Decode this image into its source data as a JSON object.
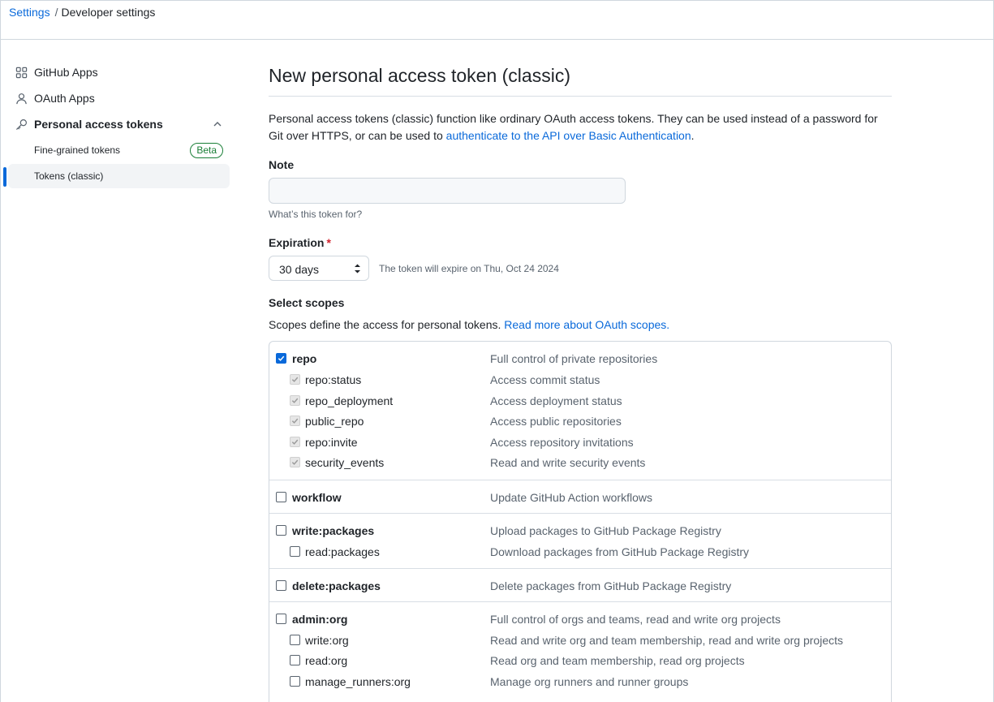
{
  "breadcrumb": {
    "settings": "Settings",
    "separator": "/",
    "current": "Developer settings"
  },
  "sidebar": {
    "items": [
      {
        "label": "GitHub Apps",
        "icon": "apps-grid-icon"
      },
      {
        "label": "OAuth Apps",
        "icon": "person-icon"
      },
      {
        "label": "Personal access tokens",
        "icon": "key-icon"
      }
    ],
    "sub_items": [
      {
        "label": "Fine-grained tokens",
        "badge": "Beta"
      },
      {
        "label": "Tokens (classic)",
        "active": true
      }
    ]
  },
  "main": {
    "title": "New personal access token (classic)",
    "intro_text": "Personal access tokens (classic) function like ordinary OAuth access tokens. They can be used instead of a password for Git over HTTPS, or can be used to ",
    "intro_link": "authenticate to the API over Basic Authentication",
    "intro_end": ".",
    "note": {
      "label": "Note",
      "value": "",
      "hint": "What’s this token for?"
    },
    "expiration": {
      "label": "Expiration",
      "required_mark": "*",
      "selected": "30 days",
      "hint": "The token will expire on Thu, Oct 24 2024"
    },
    "scopes": {
      "label": "Select scopes",
      "desc_text": "Scopes define the access for personal tokens. ",
      "desc_link": "Read more about OAuth scopes."
    }
  },
  "scopes": [
    {
      "name": "repo",
      "desc": "Full control of private repositories",
      "checked": true,
      "children": [
        {
          "name": "repo:status",
          "desc": "Access commit status"
        },
        {
          "name": "repo_deployment",
          "desc": "Access deployment status"
        },
        {
          "name": "public_repo",
          "desc": "Access public repositories"
        },
        {
          "name": "repo:invite",
          "desc": "Access repository invitations"
        },
        {
          "name": "security_events",
          "desc": "Read and write security events"
        }
      ]
    },
    {
      "name": "workflow",
      "desc": "Update GitHub Action workflows",
      "checked": false,
      "children": []
    },
    {
      "name": "write:packages",
      "desc": "Upload packages to GitHub Package Registry",
      "checked": false,
      "children": [
        {
          "name": "read:packages",
          "desc": "Download packages from GitHub Package Registry"
        }
      ]
    },
    {
      "name": "delete:packages",
      "desc": "Delete packages from GitHub Package Registry",
      "checked": false,
      "children": []
    },
    {
      "name": "admin:org",
      "desc": "Full control of orgs and teams, read and write org projects",
      "checked": false,
      "children": [
        {
          "name": "write:org",
          "desc": "Read and write org and team membership, read and write org projects"
        },
        {
          "name": "read:org",
          "desc": "Read org and team membership, read org projects"
        },
        {
          "name": "manage_runners:org",
          "desc": "Manage org runners and runner groups"
        }
      ]
    }
  ],
  "colors": {
    "accent": "#0969da",
    "success": "#1a7f37",
    "danger": "#d1242f",
    "muted": "#59636e"
  }
}
